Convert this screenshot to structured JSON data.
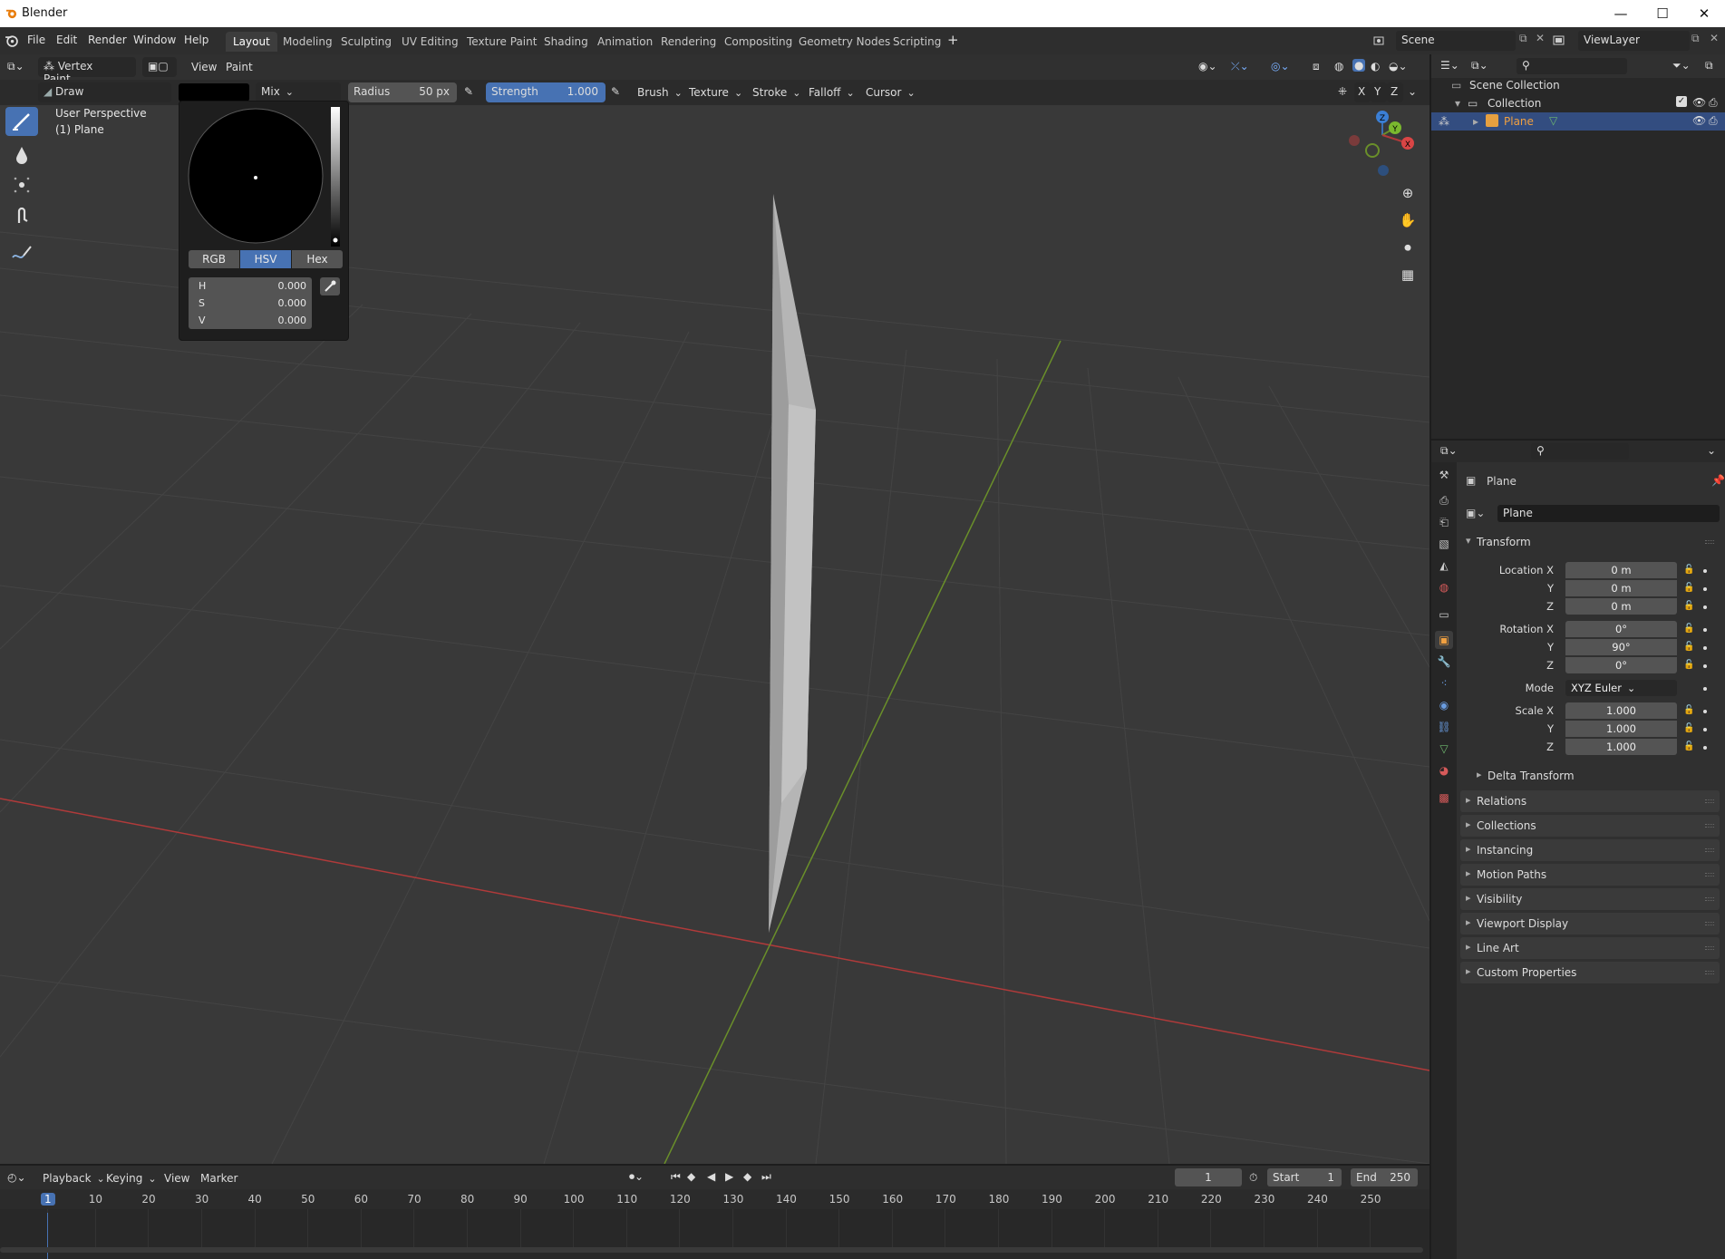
{
  "window": {
    "title": "Blender",
    "controls": [
      "—",
      "☐",
      "✕"
    ]
  },
  "menu": [
    "File",
    "Edit",
    "Render",
    "Window",
    "Help"
  ],
  "workspaces": [
    "Layout",
    "Modeling",
    "Sculpting",
    "UV Editing",
    "Texture Paint",
    "Shading",
    "Animation",
    "Rendering",
    "Compositing",
    "Geometry Nodes",
    "Scripting"
  ],
  "active_workspace": "Layout",
  "scene_field": "Scene",
  "viewlayer_field": "ViewLayer",
  "viewport_header": {
    "mode": "Vertex Paint",
    "menus": [
      "View",
      "Paint"
    ]
  },
  "tool_settings": {
    "brush": "Draw",
    "blend": "Mix",
    "radius_label": "Radius",
    "radius_value": "50 px",
    "strength_label": "Strength",
    "strength_value": "1.000",
    "menus": [
      "Brush",
      "Texture",
      "Stroke",
      "Falloff",
      "Cursor"
    ],
    "axes": [
      "X",
      "Y",
      "Z"
    ]
  },
  "viewport_info": {
    "line1": "User Perspective",
    "line2": "(1) Plane"
  },
  "color_popup": {
    "modes": [
      "RGB",
      "HSV",
      "Hex"
    ],
    "active_mode": "HSV",
    "fields": [
      {
        "key": "H",
        "value": "0.000"
      },
      {
        "key": "S",
        "value": "0.000"
      },
      {
        "key": "V",
        "value": "0.000"
      }
    ]
  },
  "gizmo_axes": [
    "Z",
    "Y",
    "X"
  ],
  "outliner": {
    "rows": [
      {
        "label": "Scene Collection"
      },
      {
        "label": "Collection"
      },
      {
        "label": "Plane"
      }
    ]
  },
  "properties": {
    "object_name": "Plane",
    "data_name": "Plane",
    "transform_title": "Transform",
    "location": {
      "label_x": "Location X",
      "label_y": "Y",
      "label_z": "Z",
      "x": "0 m",
      "y": "0 m",
      "z": "0 m"
    },
    "rotation": {
      "label_x": "Rotation X",
      "label_y": "Y",
      "label_z": "Z",
      "x": "0°",
      "y": "90°",
      "z": "0°"
    },
    "mode_label": "Mode",
    "mode_value": "XYZ Euler",
    "scale": {
      "label_x": "Scale X",
      "label_y": "Y",
      "label_z": "Z",
      "x": "1.000",
      "y": "1.000",
      "z": "1.000"
    },
    "delta": "Delta Transform",
    "panels": [
      "Relations",
      "Collections",
      "Instancing",
      "Motion Paths",
      "Visibility",
      "Viewport Display",
      "Line Art",
      "Custom Properties"
    ]
  },
  "timeline": {
    "menus": [
      "Playback",
      "Keying",
      "View",
      "Marker"
    ],
    "current_frame": "1",
    "start_label": "Start",
    "start_value": "1",
    "end_label": "End",
    "end_value": "250",
    "ticks": [
      "1",
      "10",
      "20",
      "30",
      "40",
      "50",
      "60",
      "70",
      "80",
      "90",
      "100",
      "110",
      "120",
      "130",
      "140",
      "150",
      "160",
      "170",
      "180",
      "190",
      "200",
      "210",
      "220",
      "230",
      "240",
      "250"
    ]
  },
  "colors": {
    "accent": "#4772b3",
    "x_axis": "#b03a3a",
    "y_axis": "#6a8f2a",
    "z_axis": "#3b6fb5",
    "object_orange": "#e6a040",
    "selected_text": "#f0a040"
  }
}
